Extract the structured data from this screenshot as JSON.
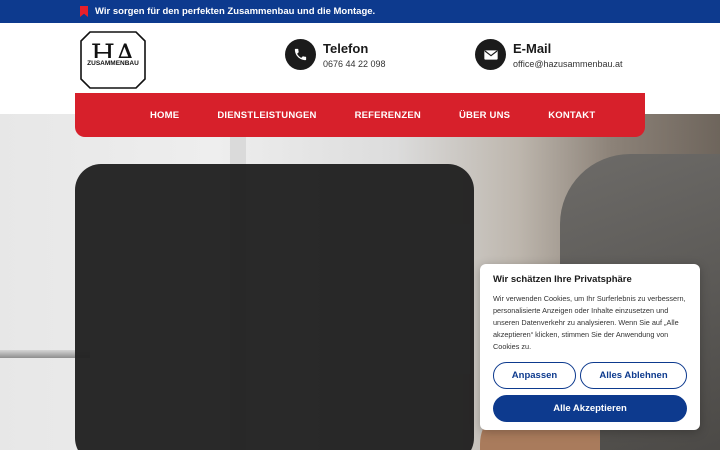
{
  "topbar": {
    "text": "Wir sorgen für den perfekten Zusammenbau und die Montage."
  },
  "logo": {
    "letters": "HA",
    "word": "ZUSAMMENBAU"
  },
  "contact": {
    "phone": {
      "title": "Telefon",
      "value": "0676 44 22 098",
      "icon": "phone-icon"
    },
    "email": {
      "title": "E-Mail",
      "value": "office@hazusammenbau.at",
      "icon": "mail-icon"
    }
  },
  "nav": {
    "items": [
      {
        "label": "HOME"
      },
      {
        "label": "DIENSTLEISTUNGEN"
      },
      {
        "label": "REFERENZEN"
      },
      {
        "label": "ÜBER UNS"
      },
      {
        "label": "KONTAKT"
      }
    ]
  },
  "cookie": {
    "title": "Wir schätzen Ihre Privatsphäre",
    "body": "Wir verwenden Cookies, um Ihr Surferlebnis zu verbessern, personalisierte Anzeigen oder Inhalte einzusetzen und unseren Datenverkehr zu analysieren. Wenn Sie auf „Alle akzeptieren“ klicken, stimmen Sie der Anwendung von Cookies zu.",
    "customize": "Anpassen",
    "reject": "Alles Ablehnen",
    "accept": "Alle Akzeptieren"
  },
  "colors": {
    "brand_blue": "#0d3a8e",
    "brand_red": "#d7202b",
    "dark": "#1b1b1b"
  }
}
